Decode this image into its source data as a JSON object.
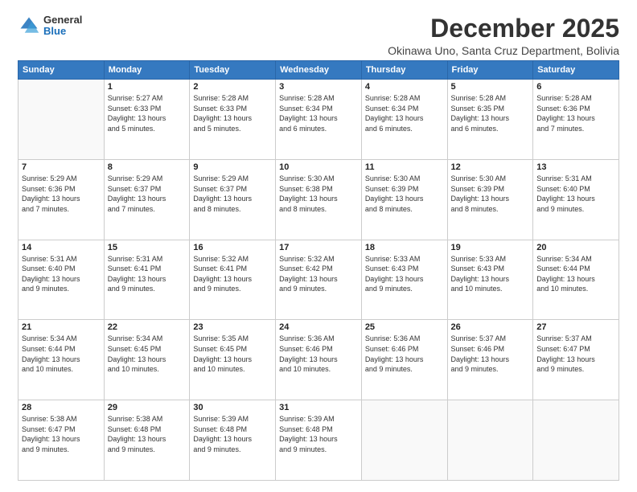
{
  "logo": {
    "general": "General",
    "blue": "Blue"
  },
  "header": {
    "month": "December 2025",
    "location": "Okinawa Uno, Santa Cruz Department, Bolivia"
  },
  "days_header": [
    "Sunday",
    "Monday",
    "Tuesday",
    "Wednesday",
    "Thursday",
    "Friday",
    "Saturday"
  ],
  "weeks": [
    [
      {
        "day": "",
        "info": ""
      },
      {
        "day": "1",
        "info": "Sunrise: 5:27 AM\nSunset: 6:33 PM\nDaylight: 13 hours\nand 5 minutes."
      },
      {
        "day": "2",
        "info": "Sunrise: 5:28 AM\nSunset: 6:33 PM\nDaylight: 13 hours\nand 5 minutes."
      },
      {
        "day": "3",
        "info": "Sunrise: 5:28 AM\nSunset: 6:34 PM\nDaylight: 13 hours\nand 6 minutes."
      },
      {
        "day": "4",
        "info": "Sunrise: 5:28 AM\nSunset: 6:34 PM\nDaylight: 13 hours\nand 6 minutes."
      },
      {
        "day": "5",
        "info": "Sunrise: 5:28 AM\nSunset: 6:35 PM\nDaylight: 13 hours\nand 6 minutes."
      },
      {
        "day": "6",
        "info": "Sunrise: 5:28 AM\nSunset: 6:36 PM\nDaylight: 13 hours\nand 7 minutes."
      }
    ],
    [
      {
        "day": "7",
        "info": "Sunrise: 5:29 AM\nSunset: 6:36 PM\nDaylight: 13 hours\nand 7 minutes."
      },
      {
        "day": "8",
        "info": "Sunrise: 5:29 AM\nSunset: 6:37 PM\nDaylight: 13 hours\nand 7 minutes."
      },
      {
        "day": "9",
        "info": "Sunrise: 5:29 AM\nSunset: 6:37 PM\nDaylight: 13 hours\nand 8 minutes."
      },
      {
        "day": "10",
        "info": "Sunrise: 5:30 AM\nSunset: 6:38 PM\nDaylight: 13 hours\nand 8 minutes."
      },
      {
        "day": "11",
        "info": "Sunrise: 5:30 AM\nSunset: 6:39 PM\nDaylight: 13 hours\nand 8 minutes."
      },
      {
        "day": "12",
        "info": "Sunrise: 5:30 AM\nSunset: 6:39 PM\nDaylight: 13 hours\nand 8 minutes."
      },
      {
        "day": "13",
        "info": "Sunrise: 5:31 AM\nSunset: 6:40 PM\nDaylight: 13 hours\nand 9 minutes."
      }
    ],
    [
      {
        "day": "14",
        "info": "Sunrise: 5:31 AM\nSunset: 6:40 PM\nDaylight: 13 hours\nand 9 minutes."
      },
      {
        "day": "15",
        "info": "Sunrise: 5:31 AM\nSunset: 6:41 PM\nDaylight: 13 hours\nand 9 minutes."
      },
      {
        "day": "16",
        "info": "Sunrise: 5:32 AM\nSunset: 6:41 PM\nDaylight: 13 hours\nand 9 minutes."
      },
      {
        "day": "17",
        "info": "Sunrise: 5:32 AM\nSunset: 6:42 PM\nDaylight: 13 hours\nand 9 minutes."
      },
      {
        "day": "18",
        "info": "Sunrise: 5:33 AM\nSunset: 6:43 PM\nDaylight: 13 hours\nand 9 minutes."
      },
      {
        "day": "19",
        "info": "Sunrise: 5:33 AM\nSunset: 6:43 PM\nDaylight: 13 hours\nand 10 minutes."
      },
      {
        "day": "20",
        "info": "Sunrise: 5:34 AM\nSunset: 6:44 PM\nDaylight: 13 hours\nand 10 minutes."
      }
    ],
    [
      {
        "day": "21",
        "info": "Sunrise: 5:34 AM\nSunset: 6:44 PM\nDaylight: 13 hours\nand 10 minutes."
      },
      {
        "day": "22",
        "info": "Sunrise: 5:34 AM\nSunset: 6:45 PM\nDaylight: 13 hours\nand 10 minutes."
      },
      {
        "day": "23",
        "info": "Sunrise: 5:35 AM\nSunset: 6:45 PM\nDaylight: 13 hours\nand 10 minutes."
      },
      {
        "day": "24",
        "info": "Sunrise: 5:36 AM\nSunset: 6:46 PM\nDaylight: 13 hours\nand 10 minutes."
      },
      {
        "day": "25",
        "info": "Sunrise: 5:36 AM\nSunset: 6:46 PM\nDaylight: 13 hours\nand 9 minutes."
      },
      {
        "day": "26",
        "info": "Sunrise: 5:37 AM\nSunset: 6:46 PM\nDaylight: 13 hours\nand 9 minutes."
      },
      {
        "day": "27",
        "info": "Sunrise: 5:37 AM\nSunset: 6:47 PM\nDaylight: 13 hours\nand 9 minutes."
      }
    ],
    [
      {
        "day": "28",
        "info": "Sunrise: 5:38 AM\nSunset: 6:47 PM\nDaylight: 13 hours\nand 9 minutes."
      },
      {
        "day": "29",
        "info": "Sunrise: 5:38 AM\nSunset: 6:48 PM\nDaylight: 13 hours\nand 9 minutes."
      },
      {
        "day": "30",
        "info": "Sunrise: 5:39 AM\nSunset: 6:48 PM\nDaylight: 13 hours\nand 9 minutes."
      },
      {
        "day": "31",
        "info": "Sunrise: 5:39 AM\nSunset: 6:48 PM\nDaylight: 13 hours\nand 9 minutes."
      },
      {
        "day": "",
        "info": ""
      },
      {
        "day": "",
        "info": ""
      },
      {
        "day": "",
        "info": ""
      }
    ]
  ]
}
